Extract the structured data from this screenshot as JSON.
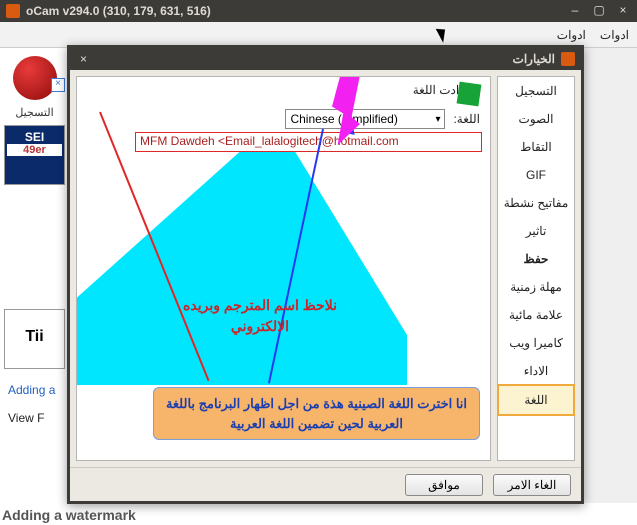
{
  "outerWindow": {
    "title": "oCam v294.0 (310, 179, 631, 516)"
  },
  "appToolbar": {
    "menu1": "ادوات",
    "menu2": "ادوات"
  },
  "leftStrip": {
    "recordLabel": "التسجيل",
    "ad1": "SEI",
    "ad1sub": "49er",
    "ad2": "Tii",
    "link1": "Adding a",
    "link2": "View F"
  },
  "bottomText": "Adding a watermark",
  "dialog": {
    "title": "الخيارات",
    "categories": [
      "التسجيل",
      "الصوت",
      "التقاط",
      "GIF",
      "مفاتيح نشطة",
      "تاثير",
      "حفظ",
      "مهلة زمنية",
      "علامة مائية",
      "كاميرا ويب",
      "الاداء",
      "اللغة"
    ],
    "selectedIndex": 11,
    "boldIndex": 6,
    "fieldsetLabel": "اعدادت اللغة",
    "langLabel": "اللغة:",
    "langValue": "Chinese (Simplified)",
    "translator": "MFM Dawdeh <Email_lalalogitech@hotmail.com",
    "annot1": "نلاحظ اسم المترجم وبريده الالكتروني",
    "annot2": "انا اخترت اللغة الصينية هذة من اجل اظهار البرنامج باللغة العربية لحين تضمين اللغة العربية",
    "okBtn": "موافق",
    "cancelBtn": "الغاء الامر"
  }
}
